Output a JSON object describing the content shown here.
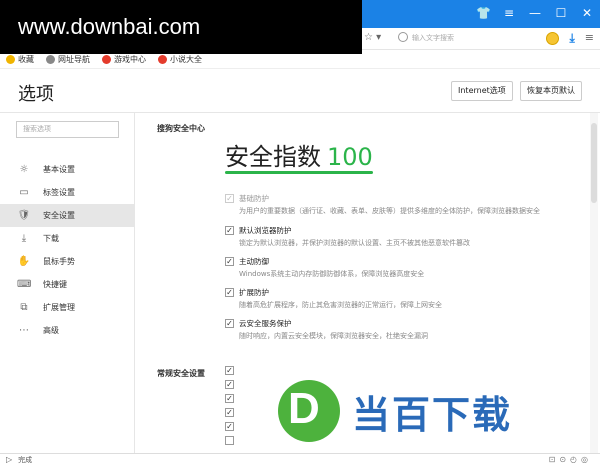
{
  "watermark": {
    "text": "www.downbai.com"
  },
  "window": {
    "controls": [
      "👕",
      "≡",
      "—",
      "☐",
      "✕"
    ]
  },
  "addressbar": {
    "search_placeholder": "输入文字搜索",
    "star": "☆ ▾",
    "menu": "≡"
  },
  "bookmarks": [
    {
      "label": "收藏",
      "color": "#f0b400"
    },
    {
      "label": "网址导航",
      "color": "#888888"
    },
    {
      "label": "游戏中心",
      "color": "#e43b2c"
    },
    {
      "label": "小说大全",
      "color": "#e43b2c"
    }
  ],
  "header": {
    "title": "选项",
    "internet_button": "Internet选项",
    "restore_button": "恢复本页默认"
  },
  "sidebar": {
    "search_placeholder": "搜索选项",
    "items": [
      {
        "label": "基本设置",
        "icon": "☼"
      },
      {
        "label": "标签设置",
        "icon": "▭"
      },
      {
        "label": "安全设置",
        "icon": "🛡"
      },
      {
        "label": "下载",
        "icon": "⤓"
      },
      {
        "label": "鼠标手势",
        "icon": "✋"
      },
      {
        "label": "快捷键",
        "icon": "⌨"
      },
      {
        "label": "扩展管理",
        "icon": "⧉"
      },
      {
        "label": "高级",
        "icon": "⋯"
      }
    ],
    "active_index": 2
  },
  "security": {
    "section_title": "搜狗安全中心",
    "score_label": "安全指数",
    "score_value": "100",
    "options": [
      {
        "title": "基础防护",
        "desc": "为用户的重要数据（通行证、收藏、表单、皮肤等）提供多维度的全体防护，保障浏览器数据安全",
        "checked": true,
        "disabled": true
      },
      {
        "title": "默认浏览器防护",
        "desc": "锁定为默认浏览器，并保护浏览器的默认设置、主页不被其他恶意软件篡改",
        "checked": true,
        "disabled": false
      },
      {
        "title": "主动防御",
        "desc": "Windows系统主动内存防御防御体系，保障浏览器高度安全",
        "checked": true,
        "disabled": false
      },
      {
        "title": "扩展防护",
        "desc": "随着高危扩展程序，防止其危害浏览器的正常运行，保障上网安全",
        "checked": true,
        "disabled": false
      },
      {
        "title": "云安全服务保护",
        "desc": "随时响应，内置云安全模块，保障浏览器安全，杜绝安全漏洞",
        "checked": true,
        "disabled": false
      }
    ],
    "regular_section_title": "常规安全设置"
  },
  "status": {
    "text": "完成"
  },
  "brand": {
    "letter": "D",
    "text": "当百下载"
  }
}
